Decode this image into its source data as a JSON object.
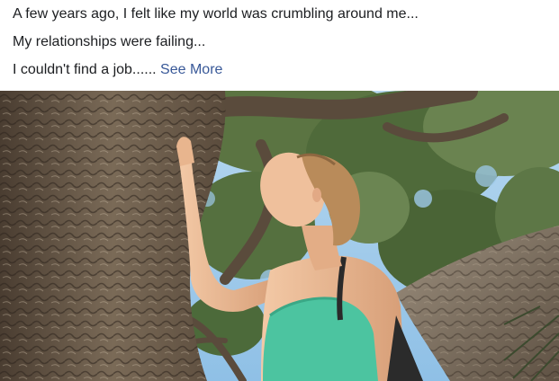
{
  "post": {
    "lines": [
      "A few years ago, I felt like my world was crumbling around me...",
      "My relationships were failing...",
      "I couldn't find a job......"
    ],
    "see_more_label": "See More"
  },
  "photo": {
    "subject": "woman-touching-tree",
    "colors": {
      "sky": "#9ec9ea",
      "foliage": "#4f6a3a",
      "bark": "#6b5a48",
      "tank_top": "#4cc4a0",
      "skin": "#e9b892",
      "hair": "#b98b5a"
    }
  }
}
